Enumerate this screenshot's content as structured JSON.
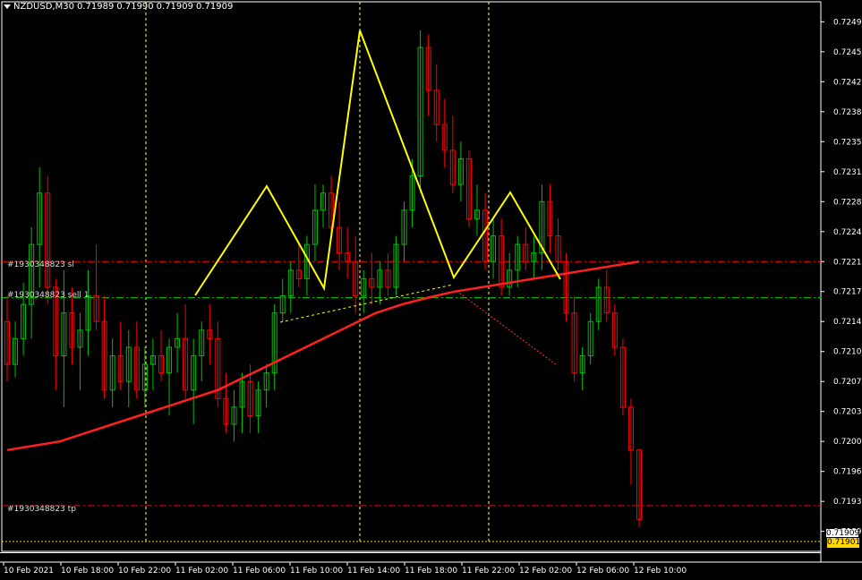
{
  "header": {
    "symbol": "NZDUSD,M30",
    "open": "0.71989",
    "high": "0.71990",
    "low": "0.71909",
    "close": "0.71909"
  },
  "orders": {
    "sl_label": "#1930348823 sl",
    "sell_label": "#1930348823 sell 1",
    "tp_label": "#1930348823 tp",
    "sl_price": 0.7221,
    "sell_price": 0.72168,
    "tp_price": 0.71925
  },
  "price_axis": {
    "labels": [
      "0.72490",
      "0.72455",
      "0.72420",
      "0.72385",
      "0.72350",
      "0.72315",
      "0.72280",
      "0.72245",
      "0.72210",
      "0.72175",
      "0.72140",
      "0.72105",
      "0.72070",
      "0.72035",
      "0.72000",
      "0.71965",
      "0.71930",
      "0.71895"
    ],
    "current_price": "0.71901",
    "bid_price": "0.71909"
  },
  "time_axis": {
    "labels": [
      "10 Feb 2021",
      "10 Feb 18:00",
      "10 Feb 22:00",
      "11 Feb 02:00",
      "11 Feb 06:00",
      "11 Feb 10:00",
      "11 Feb 14:00",
      "11 Feb 18:00",
      "11 Feb 22:00",
      "12 Feb 02:00",
      "12 Feb 06:00",
      "12 Feb 10:00"
    ]
  },
  "colors": {
    "background": "#000000",
    "bull": "#00c000",
    "bear": "#ff0000",
    "moving_average": "#ff2020",
    "pattern": "#ffff00",
    "grid": "#ffffff"
  },
  "chart_data": {
    "type": "candlestick",
    "ylim": [
      0.7188,
      0.72505
    ],
    "series": [
      {
        "name": "NZDUSD,M30",
        "ohlc": [
          [
            0.7214,
            0.7217,
            0.7207,
            0.7209
          ],
          [
            0.7209,
            0.7214,
            0.72075,
            0.7212
          ],
          [
            0.7212,
            0.72185,
            0.721,
            0.7216
          ],
          [
            0.7216,
            0.7225,
            0.7212,
            0.7223
          ],
          [
            0.7223,
            0.7232,
            0.7218,
            0.7229
          ],
          [
            0.7229,
            0.7231,
            0.7216,
            0.7218
          ],
          [
            0.7218,
            0.7219,
            0.7206,
            0.721
          ],
          [
            0.721,
            0.722,
            0.7204,
            0.7215
          ],
          [
            0.7215,
            0.7218,
            0.7209,
            0.7211
          ],
          [
            0.7211,
            0.7215,
            0.7206,
            0.7213
          ],
          [
            0.7213,
            0.722,
            0.721,
            0.7217
          ],
          [
            0.7217,
            0.7223,
            0.7213,
            0.7214
          ],
          [
            0.7214,
            0.7217,
            0.7205,
            0.7206
          ],
          [
            0.7206,
            0.7212,
            0.7204,
            0.721
          ],
          [
            0.721,
            0.7214,
            0.7206,
            0.7207
          ],
          [
            0.7207,
            0.7213,
            0.7204,
            0.7211
          ],
          [
            0.7211,
            0.7214,
            0.7205,
            0.7206
          ],
          [
            0.7206,
            0.7211,
            0.7204,
            0.7209
          ],
          [
            0.7209,
            0.7212,
            0.7206,
            0.721
          ],
          [
            0.721,
            0.7213,
            0.7207,
            0.7208
          ],
          [
            0.7208,
            0.7212,
            0.7203,
            0.7211
          ],
          [
            0.7211,
            0.7215,
            0.7208,
            0.7212
          ],
          [
            0.7212,
            0.7216,
            0.7205,
            0.7206
          ],
          [
            0.7206,
            0.7212,
            0.7202,
            0.721
          ],
          [
            0.721,
            0.7214,
            0.7207,
            0.7213
          ],
          [
            0.7213,
            0.7216,
            0.7209,
            0.7212
          ],
          [
            0.7212,
            0.7214,
            0.7204,
            0.7205
          ],
          [
            0.7205,
            0.7208,
            0.7201,
            0.7202
          ],
          [
            0.7202,
            0.7206,
            0.72,
            0.7204
          ],
          [
            0.7204,
            0.7208,
            0.7201,
            0.7207
          ],
          [
            0.7207,
            0.7209,
            0.7201,
            0.7203
          ],
          [
            0.7203,
            0.7207,
            0.7201,
            0.7206
          ],
          [
            0.7206,
            0.7209,
            0.7204,
            0.7208
          ],
          [
            0.7208,
            0.7216,
            0.7206,
            0.7215
          ],
          [
            0.7215,
            0.7219,
            0.7214,
            0.7217
          ],
          [
            0.7217,
            0.7221,
            0.7215,
            0.722
          ],
          [
            0.722,
            0.7223,
            0.7218,
            0.7219
          ],
          [
            0.7219,
            0.7224,
            0.7217,
            0.7223
          ],
          [
            0.7223,
            0.723,
            0.7221,
            0.7227
          ],
          [
            0.7227,
            0.723,
            0.7225,
            0.7229
          ],
          [
            0.7229,
            0.7231,
            0.7224,
            0.7225
          ],
          [
            0.7225,
            0.7228,
            0.722,
            0.7222
          ],
          [
            0.7222,
            0.7225,
            0.7219,
            0.7221
          ],
          [
            0.7221,
            0.7224,
            0.7215,
            0.7217
          ],
          [
            0.7217,
            0.722,
            0.7215,
            0.7219
          ],
          [
            0.7219,
            0.7222,
            0.7216,
            0.7218
          ],
          [
            0.7218,
            0.7221,
            0.7216,
            0.722
          ],
          [
            0.722,
            0.7222,
            0.7217,
            0.7218
          ],
          [
            0.7218,
            0.7224,
            0.7217,
            0.7223
          ],
          [
            0.7223,
            0.7228,
            0.7221,
            0.7227
          ],
          [
            0.7227,
            0.7233,
            0.7225,
            0.7231
          ],
          [
            0.7231,
            0.7248,
            0.7229,
            0.7246
          ],
          [
            0.7246,
            0.72475,
            0.7238,
            0.7241
          ],
          [
            0.7241,
            0.7244,
            0.7235,
            0.7237
          ],
          [
            0.7237,
            0.724,
            0.7232,
            0.7234
          ],
          [
            0.7234,
            0.7238,
            0.7229,
            0.723
          ],
          [
            0.723,
            0.7235,
            0.7228,
            0.7233
          ],
          [
            0.7233,
            0.7234,
            0.7225,
            0.7226
          ],
          [
            0.7226,
            0.723,
            0.7224,
            0.7227
          ],
          [
            0.7227,
            0.7229,
            0.722,
            0.7221
          ],
          [
            0.7221,
            0.7226,
            0.7219,
            0.7224
          ],
          [
            0.7224,
            0.7226,
            0.7217,
            0.7218
          ],
          [
            0.7218,
            0.7222,
            0.7217,
            0.722
          ],
          [
            0.722,
            0.7224,
            0.7218,
            0.7223
          ],
          [
            0.7223,
            0.7225,
            0.722,
            0.7221
          ],
          [
            0.7221,
            0.7224,
            0.7219,
            0.7222
          ],
          [
            0.7222,
            0.723,
            0.722,
            0.7228
          ],
          [
            0.7228,
            0.723,
            0.7222,
            0.7224
          ],
          [
            0.7224,
            0.7226,
            0.722,
            0.7221
          ],
          [
            0.7221,
            0.7222,
            0.7214,
            0.7215
          ],
          [
            0.7215,
            0.7217,
            0.7207,
            0.7208
          ],
          [
            0.7208,
            0.7211,
            0.7206,
            0.721
          ],
          [
            0.721,
            0.7215,
            0.7209,
            0.7214
          ],
          [
            0.7214,
            0.7219,
            0.7213,
            0.7218
          ],
          [
            0.7218,
            0.722,
            0.7214,
            0.7215
          ],
          [
            0.7215,
            0.7216,
            0.721,
            0.7211
          ],
          [
            0.7211,
            0.7212,
            0.7203,
            0.7204
          ],
          [
            0.7204,
            0.7205,
            0.7195,
            0.7199
          ],
          [
            0.7199,
            0.7199,
            0.719,
            0.71909
          ]
        ]
      },
      {
        "name": "MA",
        "values": [
          0.7199,
          0.71995,
          0.72,
          0.7201,
          0.7202,
          0.7203,
          0.7204,
          0.7205,
          0.7206,
          0.72075,
          0.7209,
          0.72105,
          0.7212,
          0.72135,
          0.7215,
          0.7216,
          0.72168,
          0.72175,
          0.7218,
          0.72185,
          0.7219,
          0.72195,
          0.722,
          0.72205,
          0.7221
        ]
      }
    ]
  }
}
